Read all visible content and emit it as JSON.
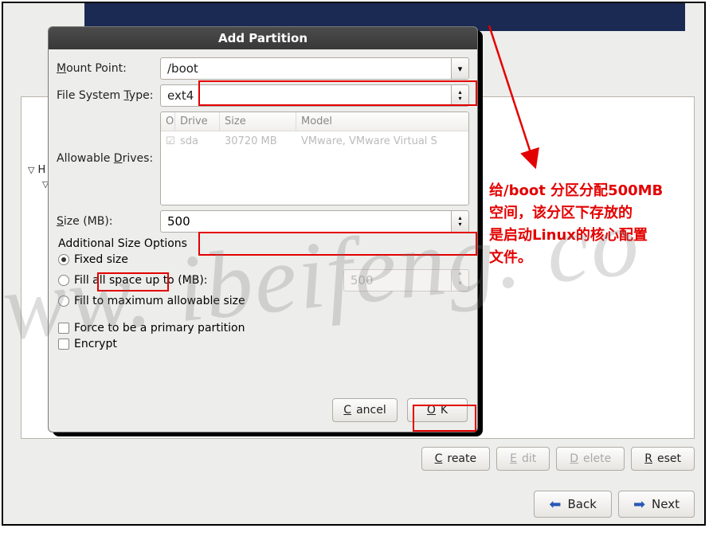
{
  "dialog": {
    "title": "Add Partition",
    "mount_point": {
      "label_pre": "M",
      "label_post": "ount Point:",
      "value": "/boot"
    },
    "fs_type": {
      "label_pre": "File System ",
      "label_ul": "T",
      "label_post": "ype:",
      "value": "ext4"
    },
    "allowable_drives": {
      "label_pre": "Allowable ",
      "label_ul": "D",
      "label_post": "rives:",
      "headers": {
        "sel": "O",
        "drive": "Drive",
        "size": "Size",
        "model": "Model"
      },
      "rows": [
        {
          "checked": "☑",
          "drive": "sda",
          "size": "30720 MB",
          "model": "VMware, VMware Virtual S"
        }
      ]
    },
    "size": {
      "label_pre": "S",
      "label_post": "ize (MB):",
      "value": "500"
    },
    "additional_label": "Additional Size Options",
    "radios": {
      "fixed": {
        "pre": "F",
        "post": "ixed size",
        "selected": true
      },
      "fill_up": {
        "pre": "Fill all space ",
        "ul": "u",
        "post": "p to (MB):",
        "selected": false,
        "spin_value": "500"
      },
      "fill_max": {
        "pre": "Fill to maximum ",
        "ul": "a",
        "post": "llowable size",
        "selected": false
      }
    },
    "checks": {
      "primary": {
        "pre": "Force to be a ",
        "ul": "p",
        "post": "rimary partition"
      },
      "encrypt": {
        "pre": "",
        "ul": "E",
        "post": "ncrypt"
      }
    },
    "buttons": {
      "cancel_pre": "C",
      "cancel_post": "ancel",
      "ok_pre": "O",
      "ok_post": "K"
    }
  },
  "main": {
    "tree": {
      "row1": "H",
      "tri": "▽"
    },
    "buttons": {
      "create_pre": "C",
      "create_post": "reate",
      "edit_pre": "E",
      "edit_post": "dit",
      "delete_pre": "D",
      "delete_post": "elete",
      "reset": "Reset"
    },
    "nav": {
      "back_pre": "B",
      "back_post": "ack",
      "next_pre": "N",
      "next_post": "ext"
    }
  },
  "annotation": {
    "line1a": "给/boot 分区分配",
    "line1b": "500MB",
    "line2": "空间，该分区下存放的",
    "line3a": "是启动",
    "line3b": "Linux",
    "line3c": "的核心配置",
    "line4": "文件。"
  },
  "watermark": "www. ibeifeng. co"
}
